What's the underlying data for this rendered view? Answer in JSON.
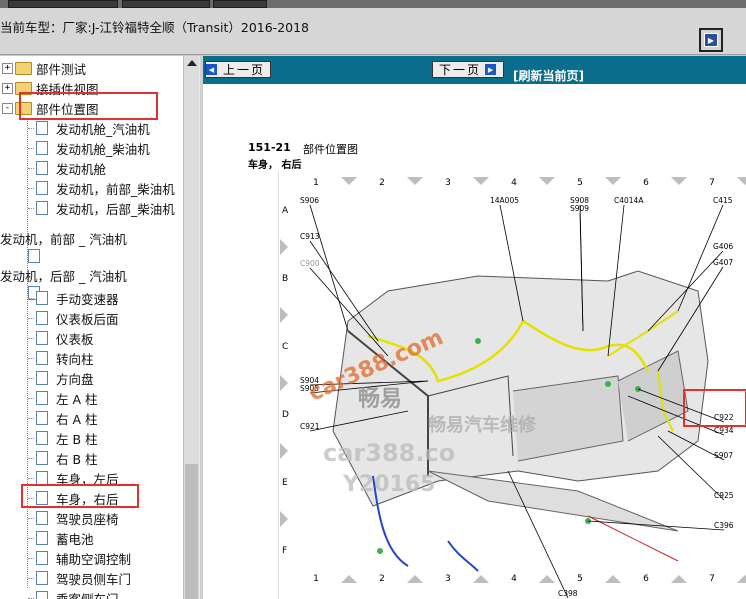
{
  "header": {
    "vehicle_label": "当前车型：厂家:J-江铃福特全顺（Transit）2016-2018"
  },
  "tree": {
    "items": [
      {
        "label": "部件测试",
        "kind": "folder",
        "expander": "+"
      },
      {
        "label": "接插件视图",
        "kind": "folder",
        "expander": "+"
      },
      {
        "label": "部件位置图",
        "kind": "folder",
        "expander": "-"
      },
      {
        "label": "发动机舱_汽油机",
        "kind": "doc"
      },
      {
        "label": "发动机舱_柴油机",
        "kind": "doc"
      },
      {
        "label": "发动机舱",
        "kind": "doc"
      },
      {
        "label": "发动机，前部_柴油机",
        "kind": "doc"
      },
      {
        "label": "发动机，后部_柴油机",
        "kind": "doc"
      },
      {
        "label": "发动机，前部 _ 汽油机",
        "kind": "doc-wrap"
      },
      {
        "label": "发动机，后部 _ 汽油机",
        "kind": "doc-wrap"
      },
      {
        "label": "手动变速器",
        "kind": "doc"
      },
      {
        "label": "仪表板后面",
        "kind": "doc"
      },
      {
        "label": "仪表板",
        "kind": "doc"
      },
      {
        "label": "转向柱",
        "kind": "doc"
      },
      {
        "label": "方向盘",
        "kind": "doc"
      },
      {
        "label": "左 A 柱",
        "kind": "doc"
      },
      {
        "label": "右 A 柱",
        "kind": "doc"
      },
      {
        "label": "左 B 柱",
        "kind": "doc"
      },
      {
        "label": "右 B 柱",
        "kind": "doc"
      },
      {
        "label": "车身，左后",
        "kind": "doc"
      },
      {
        "label": "车身，右后",
        "kind": "doc"
      },
      {
        "label": "驾驶员座椅",
        "kind": "doc"
      },
      {
        "label": "蓄电池",
        "kind": "doc"
      },
      {
        "label": "辅助空调控制",
        "kind": "doc"
      },
      {
        "label": "驾驶员侧车门",
        "kind": "doc"
      },
      {
        "label": "乘客侧车门",
        "kind": "doc"
      }
    ]
  },
  "nav": {
    "prev_label": "上一页",
    "next_label": "下一页",
    "refresh_label": "[刷新当前页]"
  },
  "page": {
    "number": "151-21",
    "title": "部件位置图",
    "subtitle": "车身，  右后"
  },
  "diagram": {
    "col_labels": [
      "1",
      "2",
      "3",
      "4",
      "5",
      "6",
      "7"
    ],
    "row_labels": [
      "A",
      "B",
      "C",
      "D",
      "E",
      "F"
    ],
    "callouts": [
      "S906",
      "14A005",
      "S908",
      "S909",
      "C4014A",
      "C415",
      "C913",
      "G406",
      "C900",
      "G407",
      "C922",
      "C934",
      "S904",
      "S905",
      "S907",
      "C921",
      "C925",
      "C396",
      "C398"
    ],
    "watermarks": [
      "car388.com",
      "畅易",
      "畅易汽车维修",
      "car388.co",
      "Y20165"
    ]
  }
}
